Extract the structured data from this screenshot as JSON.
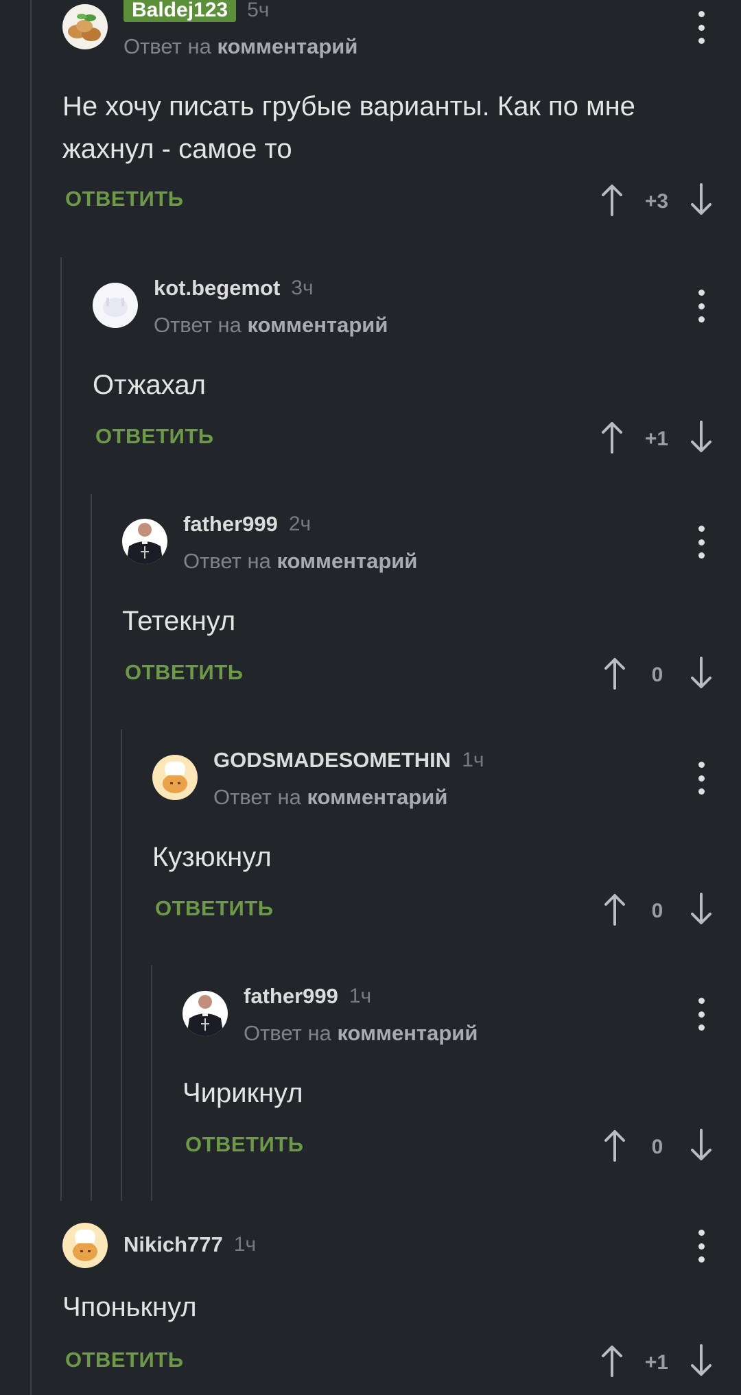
{
  "reply_to": {
    "prefix": "Ответ на",
    "link": "комментарий"
  },
  "reply_label": "ОТВЕТИТЬ",
  "colors": {
    "background": "#222529",
    "reply_green": "#6d9a48",
    "badge_green": "#5c8f3a",
    "thread_line": "#3d4045"
  },
  "comments": [
    {
      "username": "Baldej123",
      "time": "5ч",
      "text_line1": "Не хочу писать грубые варианты. Как по мне",
      "text_line2": "жахнул - самое то",
      "score": "+3",
      "avatar": "nuts-avatar"
    },
    {
      "username": "kot.begemot",
      "time": "3ч",
      "text": "Отжахал",
      "score": "+1",
      "avatar": "white-avatar"
    },
    {
      "username": "father999",
      "time": "2ч",
      "text": "Тетекнул",
      "score": "0",
      "avatar": "priest-avatar"
    },
    {
      "username": "GODSMADESOMETHIN",
      "time": "1ч",
      "text": "Кузюкнул",
      "score": "0",
      "avatar": "chef-avatar"
    },
    {
      "username": "father999",
      "time": "1ч",
      "text": "Чирикнул",
      "score": "0",
      "avatar": "priest-avatar"
    },
    {
      "username": "Nikich777",
      "time": "1ч",
      "text": "Чпонькнул",
      "score": "+1",
      "avatar": "chef-avatar"
    }
  ]
}
